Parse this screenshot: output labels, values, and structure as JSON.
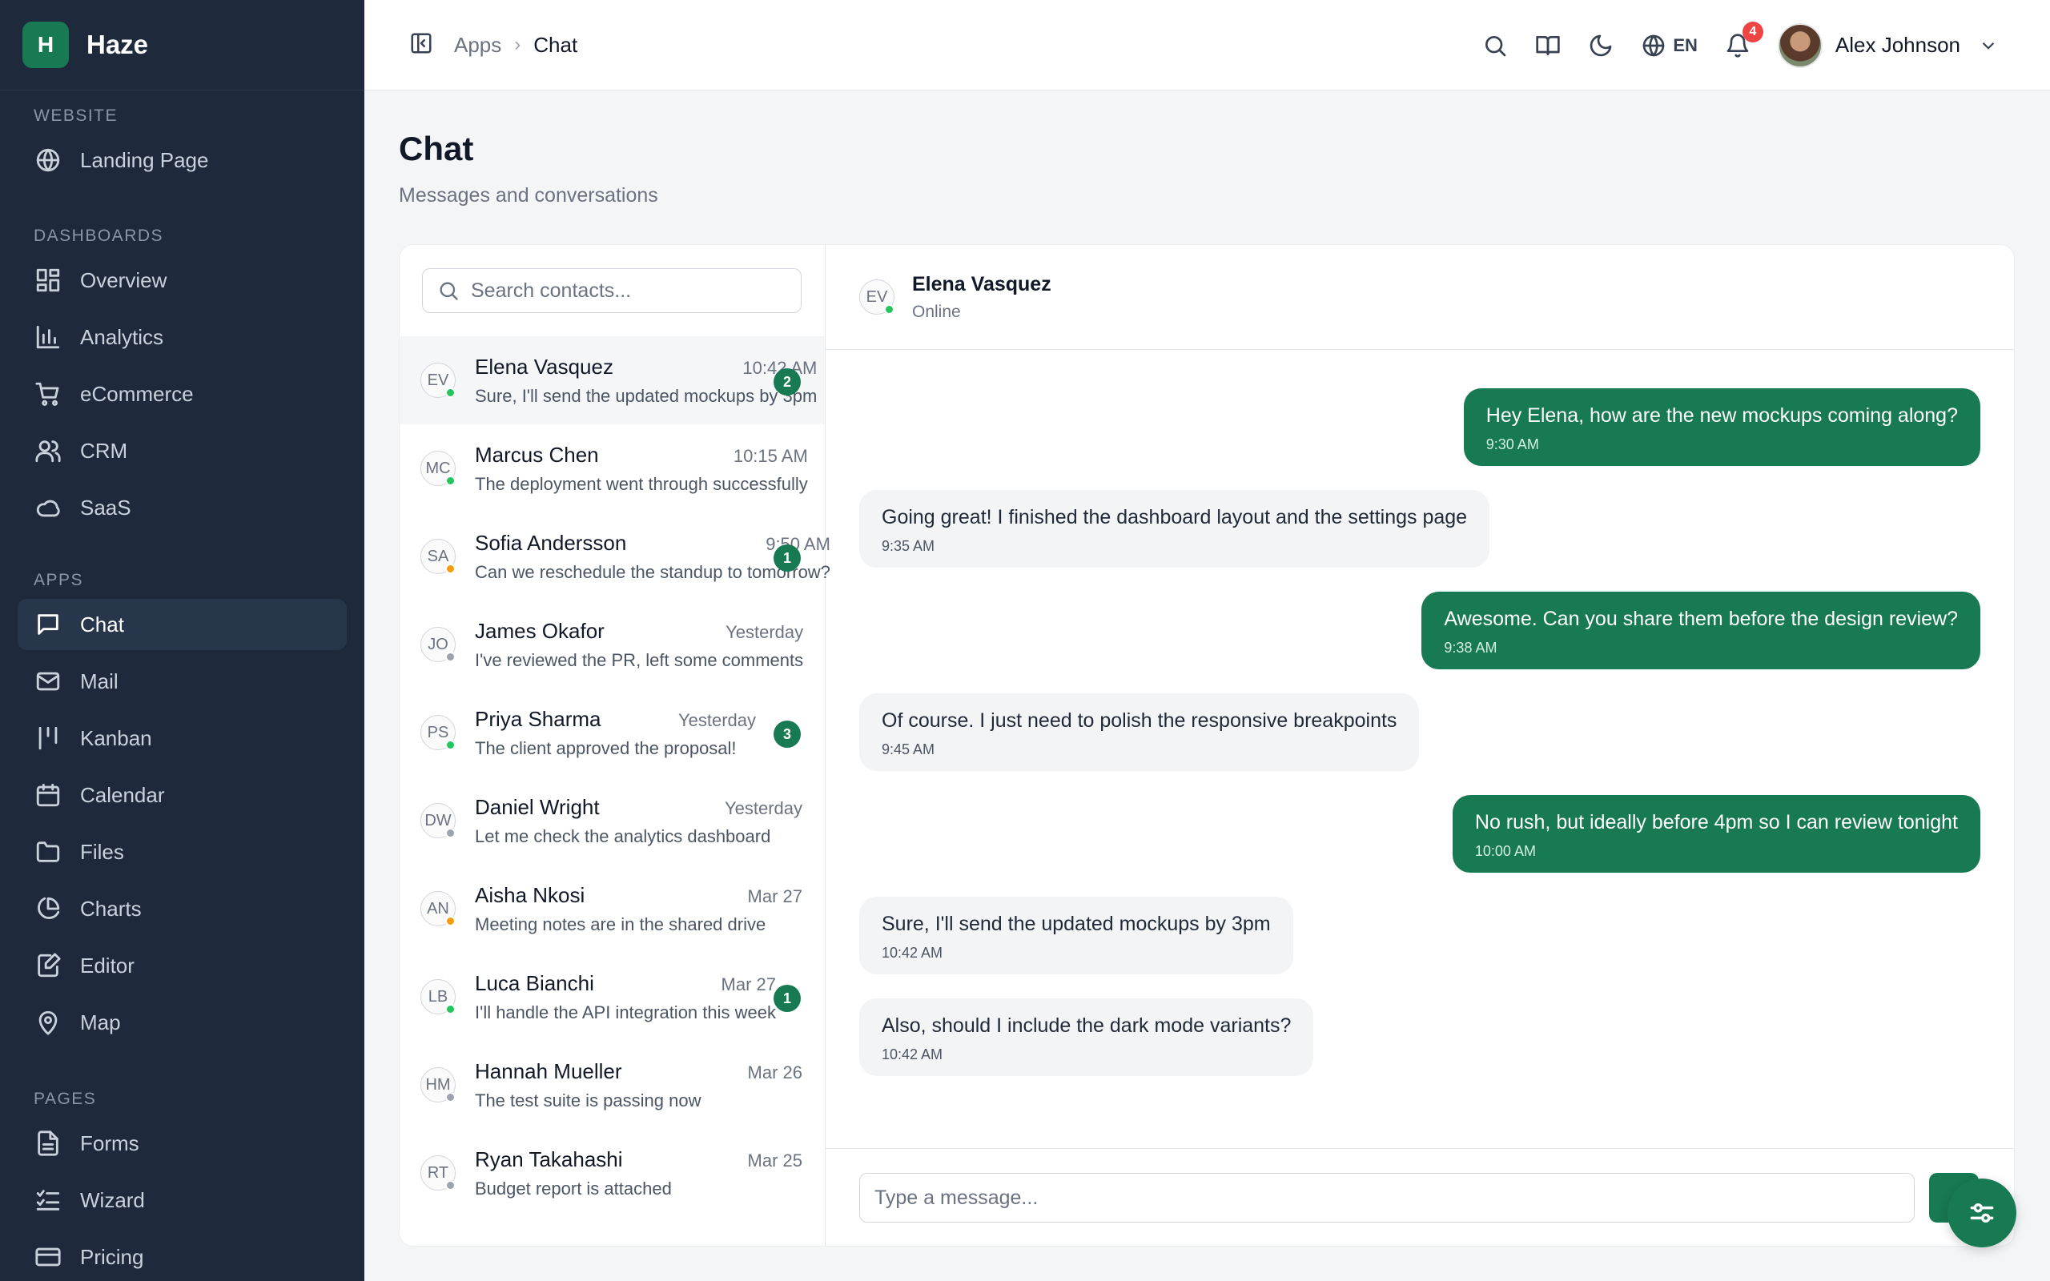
{
  "brand": {
    "logo_letter": "H",
    "name": "Haze",
    "color": "#177a52"
  },
  "sidebar": {
    "sections": [
      {
        "heading": "WEBSITE",
        "items": [
          {
            "label": "Landing Page",
            "icon": "globe-icon"
          }
        ]
      },
      {
        "heading": "DASHBOARDS",
        "items": [
          {
            "label": "Overview",
            "icon": "grid-icon"
          },
          {
            "label": "Analytics",
            "icon": "bar-chart-icon"
          },
          {
            "label": "eCommerce",
            "icon": "cart-icon"
          },
          {
            "label": "CRM",
            "icon": "users-icon"
          },
          {
            "label": "SaaS",
            "icon": "cloud-icon"
          }
        ]
      },
      {
        "heading": "APPS",
        "items": [
          {
            "label": "Chat",
            "icon": "message-icon",
            "active": true
          },
          {
            "label": "Mail",
            "icon": "mail-icon"
          },
          {
            "label": "Kanban",
            "icon": "kanban-icon"
          },
          {
            "label": "Calendar",
            "icon": "calendar-icon"
          },
          {
            "label": "Files",
            "icon": "folder-icon"
          },
          {
            "label": "Charts",
            "icon": "pie-chart-icon"
          },
          {
            "label": "Editor",
            "icon": "edit-icon"
          },
          {
            "label": "Map",
            "icon": "map-pin-icon"
          }
        ]
      },
      {
        "heading": "PAGES",
        "items": [
          {
            "label": "Forms",
            "icon": "file-text-icon"
          },
          {
            "label": "Wizard",
            "icon": "list-checks-icon"
          },
          {
            "label": "Pricing",
            "icon": "credit-card-icon"
          }
        ]
      }
    ]
  },
  "topbar": {
    "breadcrumb": {
      "parent": "Apps",
      "current": "Chat"
    },
    "language": "EN",
    "notification_count": "4",
    "user_name": "Alex Johnson"
  },
  "page": {
    "title": "Chat",
    "subtitle": "Messages and conversations"
  },
  "contacts": {
    "search_placeholder": "Search contacts...",
    "items": [
      {
        "initials": "EV",
        "name": "Elena Vasquez",
        "time": "10:42 AM",
        "preview": "Sure, I'll send the updated mockups by 3pm",
        "badge": "2",
        "status": "online",
        "active": true
      },
      {
        "initials": "MC",
        "name": "Marcus Chen",
        "time": "10:15 AM",
        "preview": "The deployment went through successfully",
        "badge": "",
        "status": "online"
      },
      {
        "initials": "SA",
        "name": "Sofia Andersson",
        "time": "9:50 AM",
        "preview": "Can we reschedule the standup to tomorrow?",
        "badge": "1",
        "status": "away"
      },
      {
        "initials": "JO",
        "name": "James Okafor",
        "time": "Yesterday",
        "preview": "I've reviewed the PR, left some comments",
        "badge": "",
        "status": "offline"
      },
      {
        "initials": "PS",
        "name": "Priya Sharma",
        "time": "Yesterday",
        "preview": "The client approved the proposal!",
        "badge": "3",
        "status": "online"
      },
      {
        "initials": "DW",
        "name": "Daniel Wright",
        "time": "Yesterday",
        "preview": "Let me check the analytics dashboard",
        "badge": "",
        "status": "offline"
      },
      {
        "initials": "AN",
        "name": "Aisha Nkosi",
        "time": "Mar 27",
        "preview": "Meeting notes are in the shared drive",
        "badge": "",
        "status": "away"
      },
      {
        "initials": "LB",
        "name": "Luca Bianchi",
        "time": "Mar 27",
        "preview": "I'll handle the API integration this week",
        "badge": "1",
        "status": "online"
      },
      {
        "initials": "HM",
        "name": "Hannah Mueller",
        "time": "Mar 26",
        "preview": "The test suite is passing now",
        "badge": "",
        "status": "offline"
      },
      {
        "initials": "RT",
        "name": "Ryan Takahashi",
        "time": "Mar 25",
        "preview": "Budget report is attached",
        "badge": "",
        "status": "offline"
      }
    ]
  },
  "status_colors": {
    "online": "#22c55e",
    "away": "#f59e0b",
    "offline": "#9ca3af"
  },
  "conversation": {
    "contact": {
      "initials": "EV",
      "name": "Elena Vasquez",
      "status_text": "Online",
      "status": "online"
    },
    "messages": [
      {
        "direction": "out",
        "text": "Hey Elena, how are the new mockups coming along?",
        "time": "9:30 AM"
      },
      {
        "direction": "in",
        "text": "Going great! I finished the dashboard layout and the settings page",
        "time": "9:35 AM"
      },
      {
        "direction": "out",
        "text": "Awesome. Can you share them before the design review?",
        "time": "9:38 AM"
      },
      {
        "direction": "in",
        "text": "Of course. I just need to polish the responsive breakpoints",
        "time": "9:45 AM"
      },
      {
        "direction": "out",
        "text": "No rush, but ideally before 4pm so I can review tonight",
        "time": "10:00 AM"
      },
      {
        "direction": "in",
        "text": "Sure, I'll send the updated mockups by 3pm",
        "time": "10:42 AM"
      },
      {
        "direction": "in",
        "text": "Also, should I include the dark mode variants?",
        "time": "10:42 AM"
      }
    ],
    "input_placeholder": "Type a message..."
  }
}
